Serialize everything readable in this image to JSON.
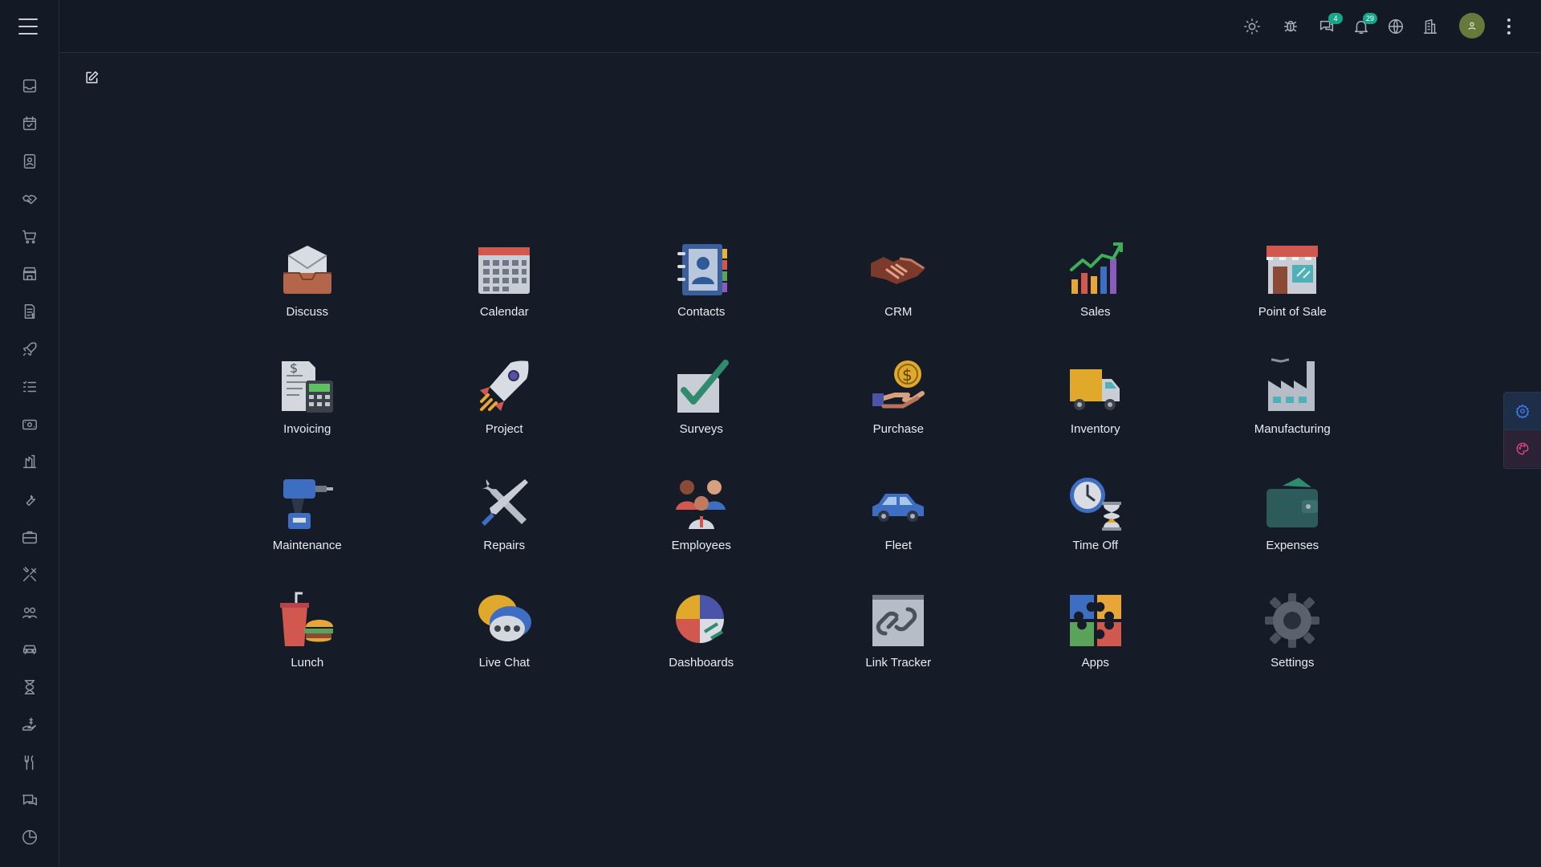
{
  "colors": {
    "background": "#151c28",
    "sidebar": "#131a25",
    "badge": "#14a58a",
    "avatar": "#667a3b",
    "float_gear": "#3b82f6",
    "float_palette": "#e2448f"
  },
  "sidebar": {
    "items": [
      {
        "icon": "inbox-icon"
      },
      {
        "icon": "calendar-check-icon"
      },
      {
        "icon": "contact-card-icon"
      },
      {
        "icon": "handshake-icon"
      },
      {
        "icon": "cart-icon"
      },
      {
        "icon": "store-icon"
      },
      {
        "icon": "invoice-icon"
      },
      {
        "icon": "rocket-icon"
      },
      {
        "icon": "checklist-icon"
      },
      {
        "icon": "money-icon"
      },
      {
        "icon": "factory-icon"
      },
      {
        "icon": "wrench-icon"
      },
      {
        "icon": "briefcase-icon"
      },
      {
        "icon": "tools-icon"
      },
      {
        "icon": "users-icon"
      },
      {
        "icon": "car-icon"
      },
      {
        "icon": "hourglass-icon"
      },
      {
        "icon": "hand-dollar-icon"
      },
      {
        "icon": "utensils-icon"
      },
      {
        "icon": "chat-icon"
      },
      {
        "icon": "pie-chart-icon"
      }
    ]
  },
  "topbar": {
    "icons": [
      "sun-icon",
      "bug-icon",
      "messages-icon",
      "bell-icon",
      "globe-icon",
      "building-icon"
    ],
    "messages_badge": "4",
    "notifications_badge": "29"
  },
  "apps": [
    {
      "label": "Discuss",
      "icon": "discuss-icon"
    },
    {
      "label": "Calendar",
      "icon": "calendar-icon"
    },
    {
      "label": "Contacts",
      "icon": "contacts-icon"
    },
    {
      "label": "CRM",
      "icon": "crm-icon"
    },
    {
      "label": "Sales",
      "icon": "sales-icon"
    },
    {
      "label": "Point of Sale",
      "icon": "point-of-sale-icon"
    },
    {
      "label": "Invoicing",
      "icon": "invoicing-icon"
    },
    {
      "label": "Project",
      "icon": "project-icon"
    },
    {
      "label": "Surveys",
      "icon": "surveys-icon"
    },
    {
      "label": "Purchase",
      "icon": "purchase-icon"
    },
    {
      "label": "Inventory",
      "icon": "inventory-icon"
    },
    {
      "label": "Manufacturing",
      "icon": "manufacturing-icon"
    },
    {
      "label": "Maintenance",
      "icon": "maintenance-icon"
    },
    {
      "label": "Repairs",
      "icon": "repairs-icon"
    },
    {
      "label": "Employees",
      "icon": "employees-icon"
    },
    {
      "label": "Fleet",
      "icon": "fleet-icon"
    },
    {
      "label": "Time Off",
      "icon": "time-off-icon"
    },
    {
      "label": "Expenses",
      "icon": "expenses-icon"
    },
    {
      "label": "Lunch",
      "icon": "lunch-icon"
    },
    {
      "label": "Live Chat",
      "icon": "live-chat-icon"
    },
    {
      "label": "Dashboards",
      "icon": "dashboards-icon"
    },
    {
      "label": "Link Tracker",
      "icon": "link-tracker-icon"
    },
    {
      "label": "Apps",
      "icon": "apps-icon"
    },
    {
      "label": "Settings",
      "icon": "settings-icon"
    }
  ]
}
